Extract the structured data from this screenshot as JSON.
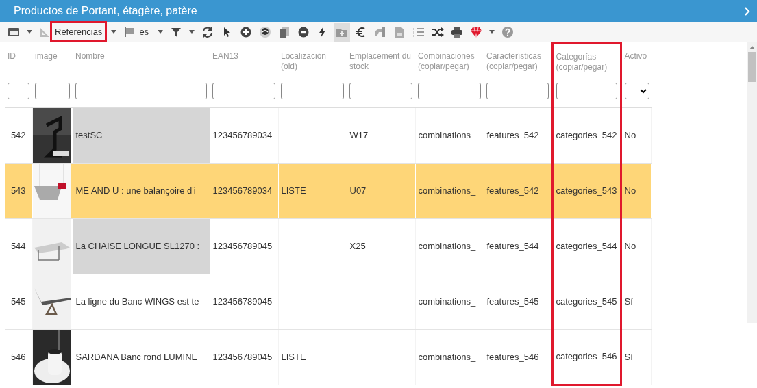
{
  "window": {
    "title": "Productos de Portant, étagère, patère"
  },
  "toolbar": [
    {
      "kind": "icon",
      "caret": true,
      "pressed": false
    },
    {
      "kind": "dropdown",
      "label": "Referencias",
      "highlighted": true
    },
    {
      "kind": "dropdown",
      "label": "es",
      "highlighted": false
    },
    {
      "kind": "icon",
      "caret": true,
      "pressed": false
    },
    {
      "kind": "icon",
      "caret": false,
      "pressed": false
    },
    {
      "kind": "icon",
      "caret": false,
      "pressed": false
    },
    {
      "kind": "icon",
      "caret": false,
      "pressed": false
    },
    {
      "kind": "icon",
      "caret": false,
      "pressed": false
    },
    {
      "kind": "icon",
      "caret": false,
      "pressed": false
    },
    {
      "kind": "icon",
      "caret": false,
      "pressed": false
    },
    {
      "kind": "icon",
      "caret": false,
      "pressed": false
    },
    {
      "kind": "icon",
      "caret": false,
      "pressed": true
    },
    {
      "kind": "icon",
      "caret": false,
      "pressed": false
    },
    {
      "kind": "icon",
      "caret": false,
      "pressed": false
    },
    {
      "kind": "icon",
      "caret": false,
      "pressed": false
    },
    {
      "kind": "icon",
      "caret": false,
      "pressed": false
    },
    {
      "kind": "icon",
      "caret": false,
      "pressed": false
    },
    {
      "kind": "icon",
      "caret": false,
      "pressed": false
    },
    {
      "kind": "icon",
      "caret": true,
      "pressed": false
    },
    {
      "kind": "icon",
      "caret": false,
      "pressed": false
    }
  ],
  "table": {
    "columns": [
      {
        "label": "ID",
        "kind": "text",
        "highlighted": false
      },
      {
        "label": "image",
        "kind": "text",
        "highlighted": false
      },
      {
        "label": "Nombre",
        "kind": "text",
        "highlighted": false
      },
      {
        "label": "EAN13",
        "kind": "text",
        "highlighted": false
      },
      {
        "label": "Localización (old)",
        "kind": "text",
        "highlighted": false
      },
      {
        "label": "Emplacement du stock",
        "kind": "text",
        "highlighted": false
      },
      {
        "label": "Combinaciones (copiar/pegar)",
        "kind": "text",
        "highlighted": false
      },
      {
        "label": "Características (copiar/pegar)",
        "kind": "text",
        "highlighted": false
      },
      {
        "label": "Categorías (copiar/pegar)",
        "kind": "text",
        "highlighted": true
      },
      {
        "label": "Activo",
        "kind": "select",
        "highlighted": false
      }
    ],
    "rows": [
      {
        "selected": false,
        "shaded": true,
        "cells": [
          "542",
          "",
          "testSC",
          "123456789034",
          "",
          "W17",
          "combinations_",
          "features_542",
          "categories_542",
          "No"
        ]
      },
      {
        "selected": true,
        "shaded": false,
        "cells": [
          "543",
          "",
          "ME AND U : une balançoire d'i",
          "123456789034",
          "LISTE",
          "U07",
          "combinations_",
          "features_542",
          "categories_543",
          "No"
        ]
      },
      {
        "selected": false,
        "shaded": true,
        "cells": [
          "544",
          "",
          "La CHAISE LONGUE SL1270 :",
          "123456789045",
          "",
          "X25",
          "combinations_",
          "features_544",
          "categories_544",
          "No"
        ]
      },
      {
        "selected": false,
        "shaded": false,
        "cells": [
          "545",
          "",
          "La ligne du Banc WINGS est te",
          "123456789045",
          "",
          "",
          "combinations_",
          "features_545",
          "categories_545",
          "Sí"
        ]
      },
      {
        "selected": false,
        "shaded": false,
        "cells": [
          "546",
          "",
          "SARDANA Banc rond LUMINE",
          "123456789045",
          "LISTE",
          "",
          "combinations_",
          "features_546",
          "categories_546",
          "Sí"
        ]
      }
    ]
  }
}
